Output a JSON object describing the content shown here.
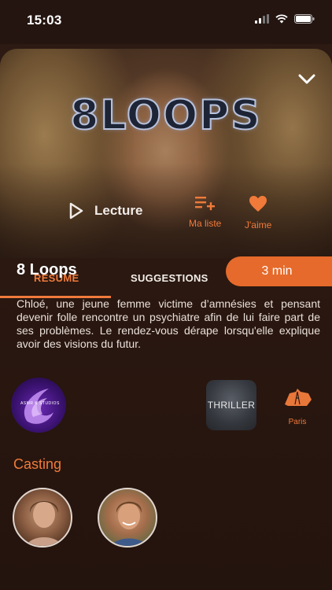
{
  "status_bar": {
    "time": "15:03"
  },
  "hero": {
    "logo_text": "8LOOPS",
    "play_label": "Lecture",
    "my_list_label": "Ma liste",
    "like_label": "J'aime"
  },
  "tabs": [
    {
      "label": "RÉSUMÉ",
      "active": true
    },
    {
      "label": "SUGGESTIONS",
      "active": false
    }
  ],
  "movie": {
    "title": "8 Loops",
    "duration": "3 min",
    "synopsis": "Chloé, une jeune femme victime d’amnésies et pensant devenir folle rencontre un psychiatre afin de lui faire part de ses problèmes. Le rendez-vous dérape lorsqu'elle explique avoir des visions du futur."
  },
  "tags": {
    "studio_label": "ASMR K STUDIOS",
    "genre_label": "THRILLER",
    "location_label": "Paris"
  },
  "casting": {
    "title": "Casting"
  },
  "colors": {
    "accent": "#f07a3a",
    "duration_pill": "#e66a2b",
    "background": "#2c1a13"
  }
}
